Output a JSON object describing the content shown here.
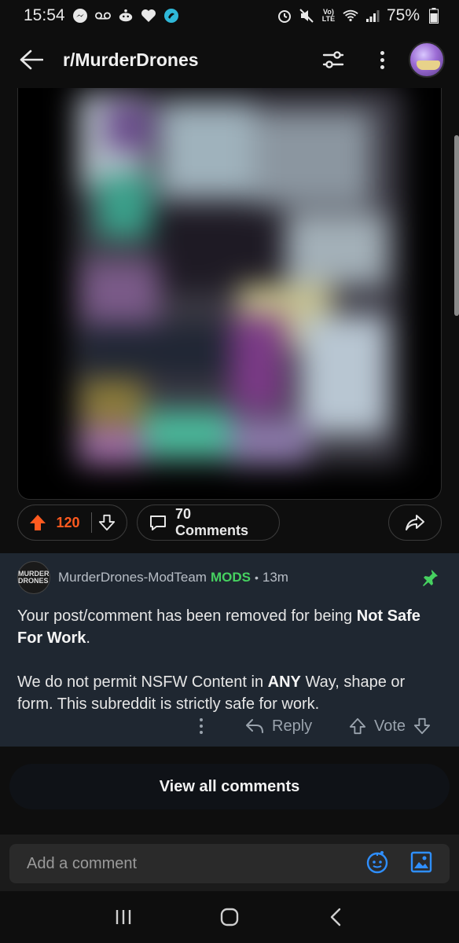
{
  "status_bar": {
    "time": "15:54",
    "battery": "75%",
    "volte": "Vo))\nLTE"
  },
  "app_bar": {
    "title": "r/MurderDrones"
  },
  "post": {
    "vote_count": "120",
    "comments_label": "70 Comments"
  },
  "mod_comment": {
    "avatar_text": "MURDER DRONES",
    "author": "MurderDrones-ModTeam",
    "badge": "MODS",
    "dot": "•",
    "age": "13m",
    "line1_prefix": "Your post/comment has been removed for being ",
    "line1_bold": "Not Safe For Work",
    "line1_suffix": ".",
    "line2_prefix": "We do not permit NSFW Content in ",
    "line2_bold": "ANY",
    "line2_suffix": " Way, shape or form. This subreddit is strictly safe for work.",
    "reply_label": "Reply",
    "vote_label": "Vote"
  },
  "view_all_label": "View all comments",
  "comment_input": {
    "placeholder": "Add a comment"
  },
  "colors": {
    "upvote": "#ff5a1f",
    "mods": "#46d160",
    "pin": "#46d160",
    "link_icon": "#2f8fff"
  }
}
